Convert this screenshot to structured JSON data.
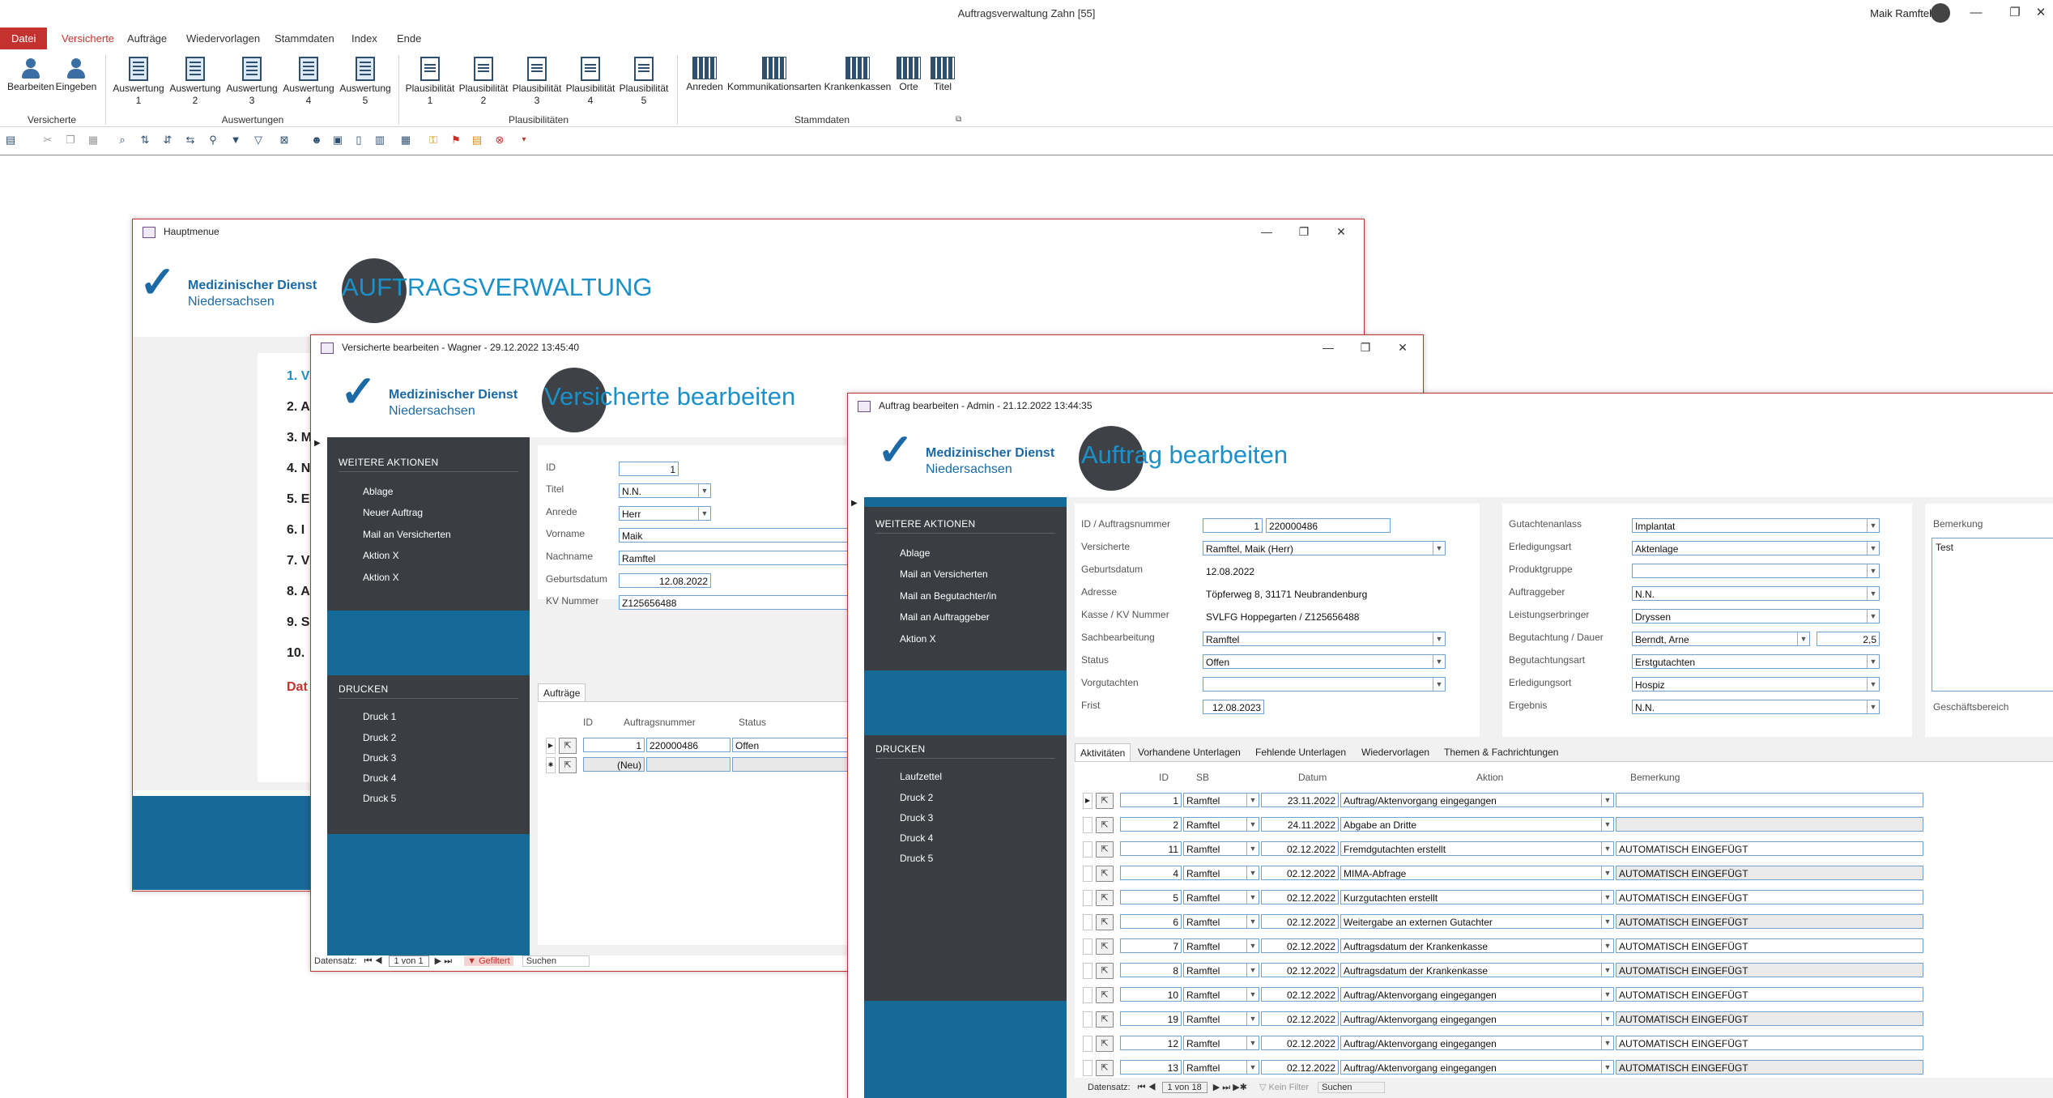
{
  "app": {
    "title": "Auftragsverwaltung Zahn [55]",
    "user": "Maik Ramftel"
  },
  "window_controls": {
    "minimize": "—",
    "restore": "❐",
    "close": "✕"
  },
  "ribbon_tabs": [
    "Datei",
    "Versicherte",
    "Aufträge",
    "Wiedervorlagen",
    "Stammdaten",
    "Index",
    "Ende"
  ],
  "ribbon": {
    "versicherte": {
      "bearbeiten": "Bearbeiten",
      "eingeben": "Eingeben",
      "group": "Versicherte"
    },
    "auswertungen": {
      "items": [
        "Auswertung",
        "Auswertung",
        "Auswertung",
        "Auswertung",
        "Auswertung"
      ],
      "nums": [
        "1",
        "2",
        "3",
        "4",
        "5"
      ],
      "group": "Auswertungen"
    },
    "plausi": {
      "items": [
        "Plausibilität",
        "Plausibilität",
        "Plausibilität",
        "Plausibilität",
        "Plausibilität"
      ],
      "nums": [
        "1",
        "2",
        "3",
        "4",
        "5"
      ],
      "group": "Plausibilitäten"
    },
    "stammdaten": {
      "items": [
        "Anreden",
        "Kommunikationsarten",
        "Krankenkassen",
        "Orte",
        "Titel"
      ],
      "group": "Stammdaten"
    }
  },
  "logo": {
    "line1": "Medizinischer Dienst",
    "line2": "Niedersachsen",
    "check": "✓"
  },
  "hauptmenue": {
    "title": "Hauptmenue",
    "big": "AUFTRAGSVERWALTUNG",
    "menu": [
      "1. V",
      "2. A",
      "3. M",
      "4. N",
      "5. E",
      "6. I",
      "7. V",
      "8. A",
      "9. S",
      "10."
    ],
    "last": "Dat"
  },
  "versicherte_win": {
    "title": "Versicherte bearbeiten - Wagner - 29.12.2022 13:45:40",
    "big": "Versicherte bearbeiten",
    "weitere": "WEITERE AKTIONEN",
    "actions": [
      "Ablage",
      "Neuer Auftrag",
      "Mail an Versicherten",
      "Aktion X",
      "Aktion X"
    ],
    "drucken": "DRUCKEN",
    "prints": [
      "Druck 1",
      "Druck 2",
      "Druck 3",
      "Druck 4",
      "Druck 5"
    ],
    "labels": [
      "ID",
      "Titel",
      "Anrede",
      "Vorname",
      "Nachname",
      "Geburtsdatum",
      "KV Nummer"
    ],
    "values": [
      "1",
      "N.N.",
      "Herr",
      "Maik",
      "Ramftel",
      "12.08.2022",
      "Z125656488"
    ],
    "tab": "Aufträge",
    "cols": [
      "ID",
      "Auftragsnummer",
      "Status"
    ],
    "row1": [
      "1",
      "220000486",
      "Offen"
    ],
    "row2": [
      "(Neu)",
      "",
      ""
    ],
    "nav": {
      "prefix": "Datensatz:",
      "pos": "1 von 1",
      "filter": "Gefiltert",
      "search": "Suchen"
    }
  },
  "auftrag_win": {
    "title": "Auftrag bearbeiten - Admin - 21.12.2022 13:44:35",
    "big": "Auftrag bearbeiten",
    "weitere": "WEITERE AKTIONEN",
    "actions": [
      "Ablage",
      "Mail an Versicherten",
      "Mail an Begutachter/in",
      "Mail an Auftraggeber",
      "Aktion X"
    ],
    "drucken": "DRUCKEN",
    "prints": [
      "Laufzettel",
      "Druck 2",
      "Druck 3",
      "Druck 4",
      "Druck 5"
    ],
    "left_labels": [
      "ID / Auftragsnummer",
      "Versicherte",
      "Geburtsdatum",
      "Adresse",
      "Kasse / KV Nummer",
      "Sachbearbeitung",
      "Status",
      "Vorgutachten",
      "Frist"
    ],
    "id": "1",
    "auftragsnummer": "220000486",
    "versicherte": "Ramftel, Maik (Herr)",
    "geburtsdatum": "12.08.2022",
    "adresse": "Töpferweg 8, 31171 Neubrandenburg",
    "kasse": "SVLFG Hoppegarten / Z125656488",
    "sachbearbeitung": "Ramftel",
    "status": "Offen",
    "vorgutachten": "",
    "frist": "12.08.2023",
    "right_labels": [
      "Gutachtenanlass",
      "Erledigungsart",
      "Produktgruppe",
      "Auftraggeber",
      "Leistungserbringer",
      "Begutachtung / Dauer",
      "Begutachtungsart",
      "Erledigungsort",
      "Ergebnis"
    ],
    "right_values": [
      "Implantat",
      "Aktenlage",
      "",
      "N.N.",
      "Dryssen",
      "Berndt, Arne",
      "Erstgutachten",
      "Hospiz",
      "N.N."
    ],
    "dauer": "2,5",
    "bemerkung_label": "Bemerkung",
    "bemerkung": "Test",
    "geschaeftsbereich": "Geschäftsbereich",
    "subtabs": [
      "Aktivitäten",
      "Vorhandene Unterlagen",
      "Fehlende Unterlagen",
      "Wiedervorlagen",
      "Themen & Fachrichtungen"
    ],
    "cols": [
      "ID",
      "SB",
      "Datum",
      "Aktion",
      "Bemerkung"
    ],
    "rows": [
      {
        "id": "1",
        "sb": "Ramftel",
        "datum": "23.11.2022",
        "aktion": "Auftrag/Aktenvorgang eingegangen",
        "bem": ""
      },
      {
        "id": "2",
        "sb": "Ramftel",
        "datum": "24.11.2022",
        "aktion": "Abgabe an Dritte",
        "bem": ""
      },
      {
        "id": "11",
        "sb": "Ramftel",
        "datum": "02.12.2022",
        "aktion": "Fremdgutachten erstellt",
        "bem": "AUTOMATISCH EINGEFÜGT"
      },
      {
        "id": "4",
        "sb": "Ramftel",
        "datum": "02.12.2022",
        "aktion": "MIMA-Abfrage",
        "bem": "AUTOMATISCH EINGEFÜGT"
      },
      {
        "id": "5",
        "sb": "Ramftel",
        "datum": "02.12.2022",
        "aktion": "Kurzgutachten erstellt",
        "bem": "AUTOMATISCH EINGEFÜGT"
      },
      {
        "id": "6",
        "sb": "Ramftel",
        "datum": "02.12.2022",
        "aktion": "Weitergabe an externen Gutachter",
        "bem": "AUTOMATISCH EINGEFÜGT"
      },
      {
        "id": "7",
        "sb": "Ramftel",
        "datum": "02.12.2022",
        "aktion": "Auftragsdatum der Krankenkasse",
        "bem": "AUTOMATISCH EINGEFÜGT"
      },
      {
        "id": "8",
        "sb": "Ramftel",
        "datum": "02.12.2022",
        "aktion": "Auftragsdatum der Krankenkasse",
        "bem": "AUTOMATISCH EINGEFÜGT"
      },
      {
        "id": "10",
        "sb": "Ramftel",
        "datum": "02.12.2022",
        "aktion": "Auftrag/Aktenvorgang eingegangen",
        "bem": "AUTOMATISCH EINGEFÜGT"
      },
      {
        "id": "19",
        "sb": "Ramftel",
        "datum": "02.12.2022",
        "aktion": "Auftrag/Aktenvorgang eingegangen",
        "bem": "AUTOMATISCH EINGEFÜGT"
      },
      {
        "id": "12",
        "sb": "Ramftel",
        "datum": "02.12.2022",
        "aktion": "Auftrag/Aktenvorgang eingegangen",
        "bem": "AUTOMATISCH EINGEFÜGT"
      },
      {
        "id": "13",
        "sb": "Ramftel",
        "datum": "02.12.2022",
        "aktion": "Auftrag/Aktenvorgang eingegangen",
        "bem": "AUTOMATISCH EINGEFÜGT"
      }
    ],
    "nav": {
      "prefix": "Datensatz:",
      "pos": "1 von 18",
      "filter": "Kein Filter",
      "search": "Suchen"
    }
  },
  "colors": {
    "accent": "#c4322f",
    "brand": "#1b6aa5",
    "title_blue": "#1b90c9",
    "nav_dark": "#3a3d42",
    "bar_blue": "#156a97"
  }
}
